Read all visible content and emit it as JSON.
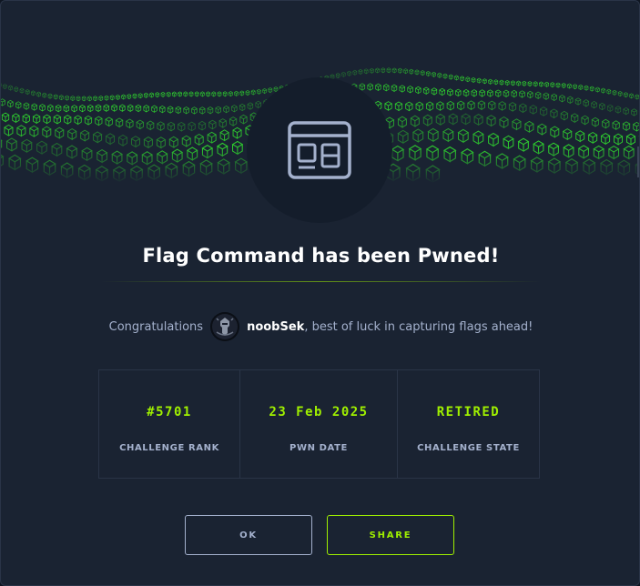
{
  "title": "Flag Command has been Pwned!",
  "congrats": {
    "prefix": "Congratulations",
    "username": "noobSek",
    "suffix": ", best of luck in capturing flags ahead!"
  },
  "stats": [
    {
      "value": "#5701",
      "label": "CHALLENGE RANK"
    },
    {
      "value": "23 Feb 2025",
      "label": "PWN DATE"
    },
    {
      "value": "RETIRED",
      "label": "CHALLENGE STATE"
    }
  ],
  "buttons": {
    "ok": "OK",
    "share": "SHARE"
  },
  "icons": {
    "badge": "web-challenge-icon",
    "avatar": "user-avatar"
  },
  "colors": {
    "background": "#1a2332",
    "accent": "#9fef00",
    "text": "#a4b1cd",
    "title": "#ffffff"
  }
}
